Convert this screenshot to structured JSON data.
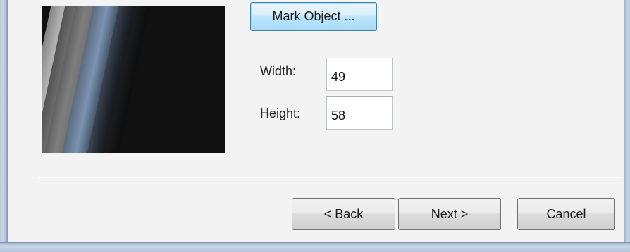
{
  "dialog": {
    "mark_object_label": "Mark Object ...",
    "width_label": "Width:",
    "width_value": "49",
    "height_label": "Height:",
    "height_value": "58"
  },
  "buttons": {
    "back_label": "< Back",
    "next_label": "Next >",
    "cancel_label": "Cancel"
  },
  "colors": {
    "focused_button_accent": "#3c7fb1",
    "dialog_background": "#f3f3f3"
  }
}
